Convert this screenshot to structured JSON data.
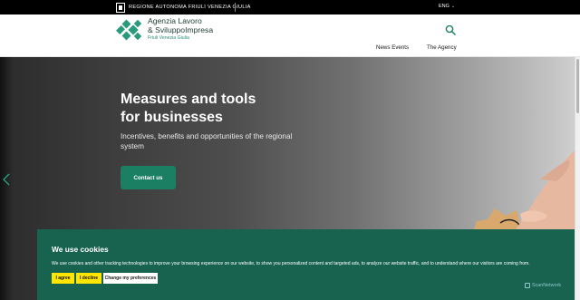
{
  "top_bar": {
    "region_name": "REGIONE AUTONOMA FRIULI VENEZIA GIULIA",
    "language": "ENG"
  },
  "header": {
    "logo": {
      "line1": "Agenzia Lavoro",
      "line2": "& SviluppoImpresa",
      "line3": "Friuli Venezia Giulia"
    },
    "nav": [
      {
        "label": "News Events"
      },
      {
        "label": "The Agency"
      }
    ]
  },
  "hero": {
    "title_line1": "Measures and tools",
    "title_line2": "for businesses",
    "subtitle": "Incentives, benefits and opportunities of the regional system",
    "cta_label": "Contact us"
  },
  "cookie_banner": {
    "title": "We use cookies",
    "text": "We use cookies and other tracking technologies to improve your browsing experience on our website, to show you personalized content and targeted ads, to analyze our website traffic, and to understand where our visitors are coming from.",
    "buttons": {
      "agree": "I agree",
      "decline": "I decline",
      "preferences": "Change my preferences"
    },
    "watermark": "ScanNetwork"
  },
  "colors": {
    "brand_green": "#1a7f63",
    "cookie_bg": "#17634f",
    "button_yellow": "#ffe600"
  },
  "icons": [
    "region-emblem-icon",
    "logo-mark-icon",
    "search-icon",
    "chevron-down-icon",
    "chevron-left-icon"
  ]
}
